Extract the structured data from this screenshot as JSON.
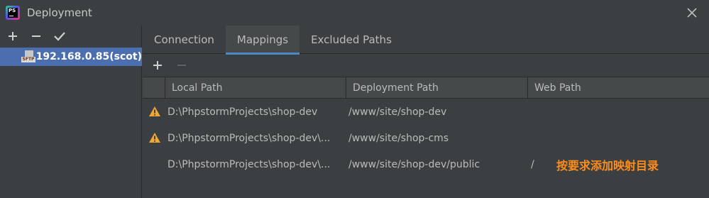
{
  "window": {
    "title": "Deployment",
    "app_icon_text": "PS",
    "icons": {
      "app": "phpstorm-icon",
      "close": "close-icon"
    }
  },
  "sidebar": {
    "toolbar": [
      {
        "icon": "plus-icon",
        "name": "add-server-button"
      },
      {
        "icon": "minus-icon",
        "name": "remove-server-button"
      },
      {
        "icon": "checkmark-icon",
        "name": "set-default-button"
      }
    ],
    "server": {
      "label": "192.168.0.85(scot)",
      "icon": "sftp-icon",
      "icon_text": "SFTP"
    }
  },
  "tabs": [
    {
      "label": "Connection"
    },
    {
      "label": "Mappings",
      "active": true
    },
    {
      "label": "Excluded Paths"
    }
  ],
  "mappings": {
    "toolbar": [
      {
        "icon": "plus-icon",
        "enabled": true
      },
      {
        "icon": "minus-icon",
        "enabled": false
      }
    ],
    "columns": [
      "Local Path",
      "Deployment Path",
      "Web Path"
    ],
    "rows": [
      {
        "warning": true,
        "local": "D:\\PhpstormProjects\\shop-dev",
        "deploy": "/www/site/shop-dev",
        "web": ""
      },
      {
        "warning": true,
        "local": "D:\\PhpstormProjects\\shop-dev\\...",
        "deploy": "/www/site/shop-cms",
        "web": ""
      },
      {
        "warning": false,
        "local": "D:\\PhpstormProjects\\shop-dev\\...",
        "deploy": "/www/site/shop-dev/public",
        "web": "/"
      }
    ],
    "annotation": "按要求添加映射目录"
  },
  "colors": {
    "background": "#3c3f41",
    "selection": "#4b6eaf",
    "tab_underline": "#4a88c7",
    "warning": "#f0a732",
    "annotation": "#ff8c1a"
  }
}
